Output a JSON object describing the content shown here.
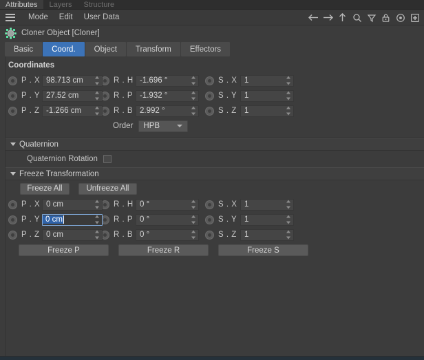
{
  "window": {
    "top_tabs": [
      {
        "label": "Attributes",
        "active": true
      },
      {
        "label": "Layers",
        "active": false
      },
      {
        "label": "Structure",
        "active": false
      }
    ]
  },
  "menubar": {
    "hamburger_icon": "hamburger-icon",
    "items": [
      "Mode",
      "Edit",
      "User Data"
    ],
    "tool_icons": [
      "arrow-left-icon",
      "arrow-right-icon",
      "arrow-up-icon",
      "search-icon",
      "filter-funnel-icon",
      "lock-icon",
      "record-target-icon",
      "plus-box-icon"
    ]
  },
  "object": {
    "icon": "cloner-object-icon",
    "title": "Cloner Object [Cloner]"
  },
  "tabs": [
    {
      "label": "Basic",
      "active": false
    },
    {
      "label": "Coord.",
      "active": true
    },
    {
      "label": "Object",
      "active": false
    },
    {
      "label": "Transform",
      "active": false
    },
    {
      "label": "Effectors",
      "active": false
    }
  ],
  "coordinates": {
    "title": "Coordinates",
    "rows": [
      {
        "pos": {
          "label": "P . X",
          "value": "98.713 cm"
        },
        "rot": {
          "label": "R . H",
          "value": "-1.696 °"
        },
        "scl": {
          "label": "S . X",
          "value": "1"
        }
      },
      {
        "pos": {
          "label": "P . Y",
          "value": "27.52 cm"
        },
        "rot": {
          "label": "R . P",
          "value": "-1.932 °"
        },
        "scl": {
          "label": "S . Y",
          "value": "1"
        }
      },
      {
        "pos": {
          "label": "P . Z",
          "value": "-1.266 cm"
        },
        "rot": {
          "label": "R . B",
          "value": "2.992 °"
        },
        "scl": {
          "label": "S . Z",
          "value": "1"
        }
      }
    ],
    "order": {
      "label": "Order",
      "value": "HPB"
    }
  },
  "quaternion": {
    "section_title": "Quaternion",
    "rotation_label": "Quaternion Rotation",
    "rotation_checked": false
  },
  "freeze": {
    "section_title": "Freeze Transformation",
    "freeze_all_label": "Freeze All",
    "unfreeze_all_label": "Unfreeze All",
    "rows": [
      {
        "pos": {
          "label": "P . X",
          "value": "0 cm"
        },
        "rot": {
          "label": "R . H",
          "value": "0 °"
        },
        "scl": {
          "label": "S . X",
          "value": "1"
        }
      },
      {
        "pos": {
          "label": "P . Y",
          "value": "0 cm",
          "editing": true
        },
        "rot": {
          "label": "R . P",
          "value": "0 °"
        },
        "scl": {
          "label": "S . Y",
          "value": "1"
        }
      },
      {
        "pos": {
          "label": "P . Z",
          "value": "0 cm"
        },
        "rot": {
          "label": "R . B",
          "value": "0 °"
        },
        "scl": {
          "label": "S . Z",
          "value": "1"
        }
      }
    ],
    "buttons": [
      "Freeze P",
      "Freeze R",
      "Freeze S"
    ]
  },
  "colors": {
    "accent_blue": "#3c73b8",
    "selection_blue": "#2f62a8",
    "panel_bg": "#3c3c3c",
    "field_bg": "#454545",
    "cloner_icon_green": "#6fd8a8"
  }
}
